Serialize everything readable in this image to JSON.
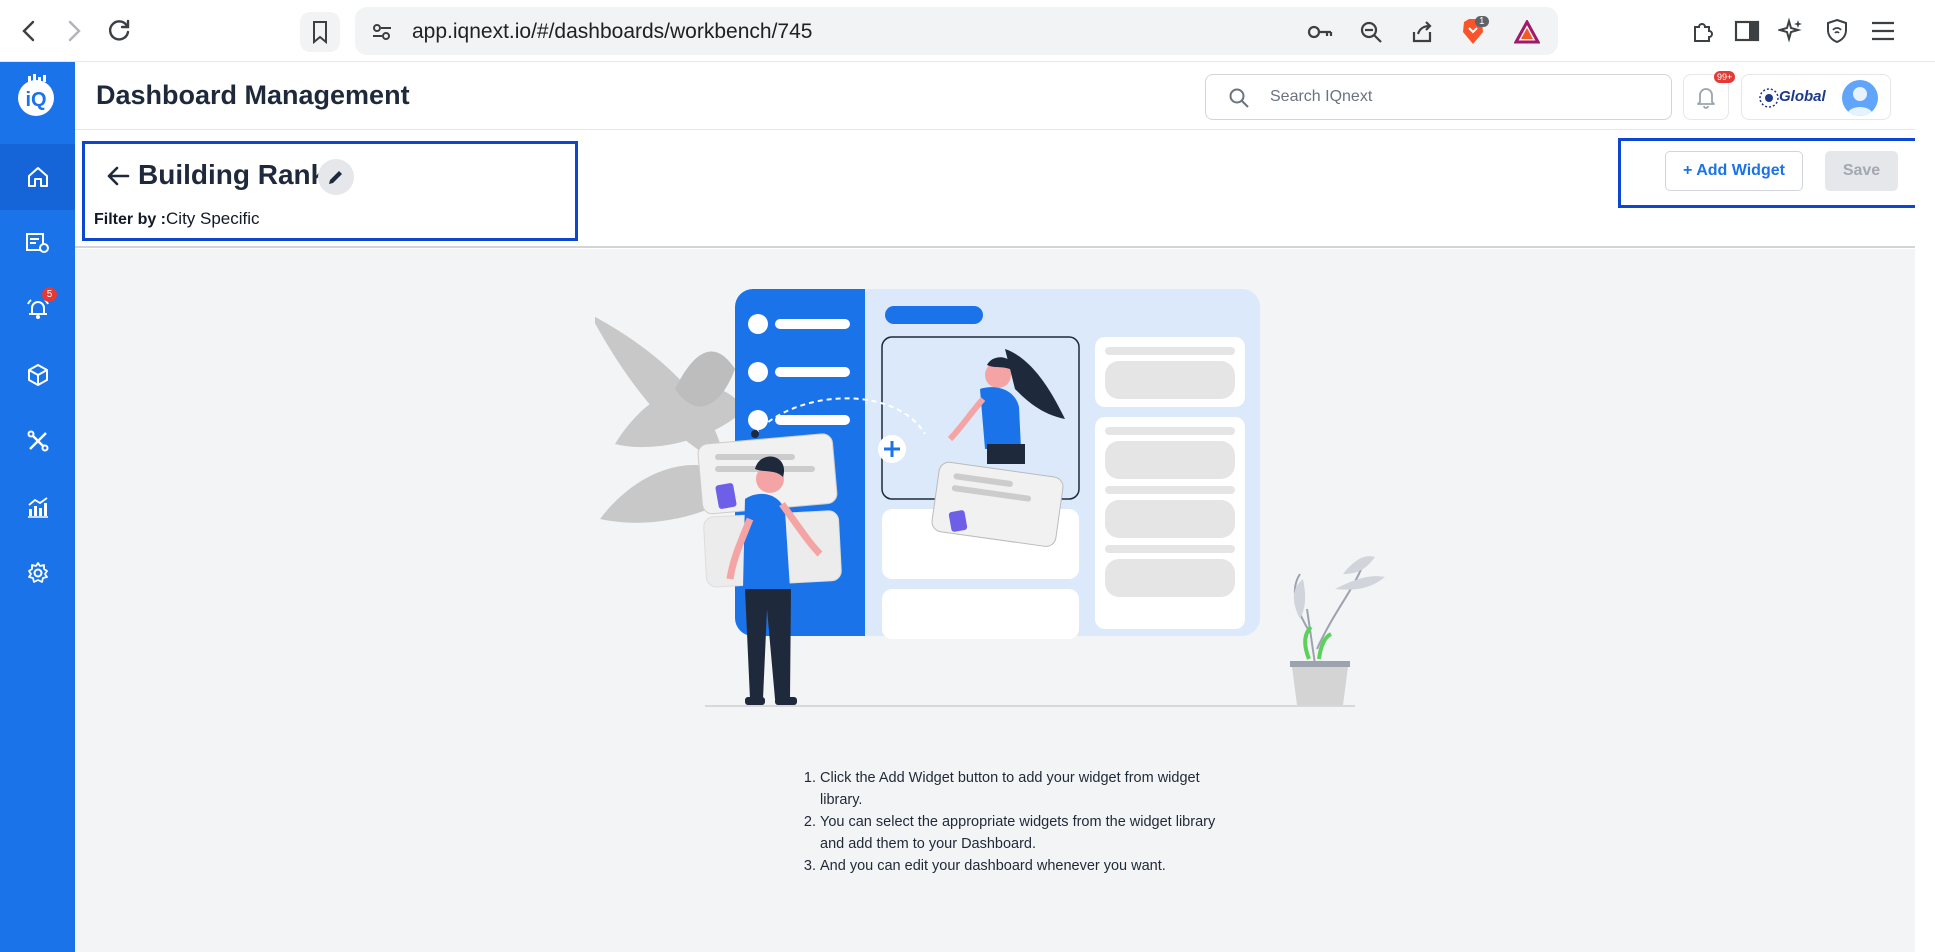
{
  "browser": {
    "url": "app.iqnext.io/#/dashboards/workbench/745",
    "brave_badge": "1"
  },
  "sidebar": {
    "alerts_badge": "5"
  },
  "header": {
    "title": "Dashboard Management",
    "search_placeholder": "Search IQnext",
    "notification_badge": "99+",
    "brand_name": "Global"
  },
  "dashboard": {
    "name": "Building Rank",
    "filter_label": "Filter by :",
    "filter_value": "City Specific"
  },
  "actions": {
    "add_widget": "+ Add Widget",
    "save": "Save"
  },
  "instructions": [
    "Click the Add Widget button to add your widget from widget library.",
    "You can select the appropriate widgets from the widget library and add them to your Dashboard.",
    "And you can edit your dashboard whenever you want."
  ],
  "colors": {
    "sidebar": "#1a73e8",
    "highlight_border": "#0b47d1",
    "accent": "#1a73e8"
  }
}
